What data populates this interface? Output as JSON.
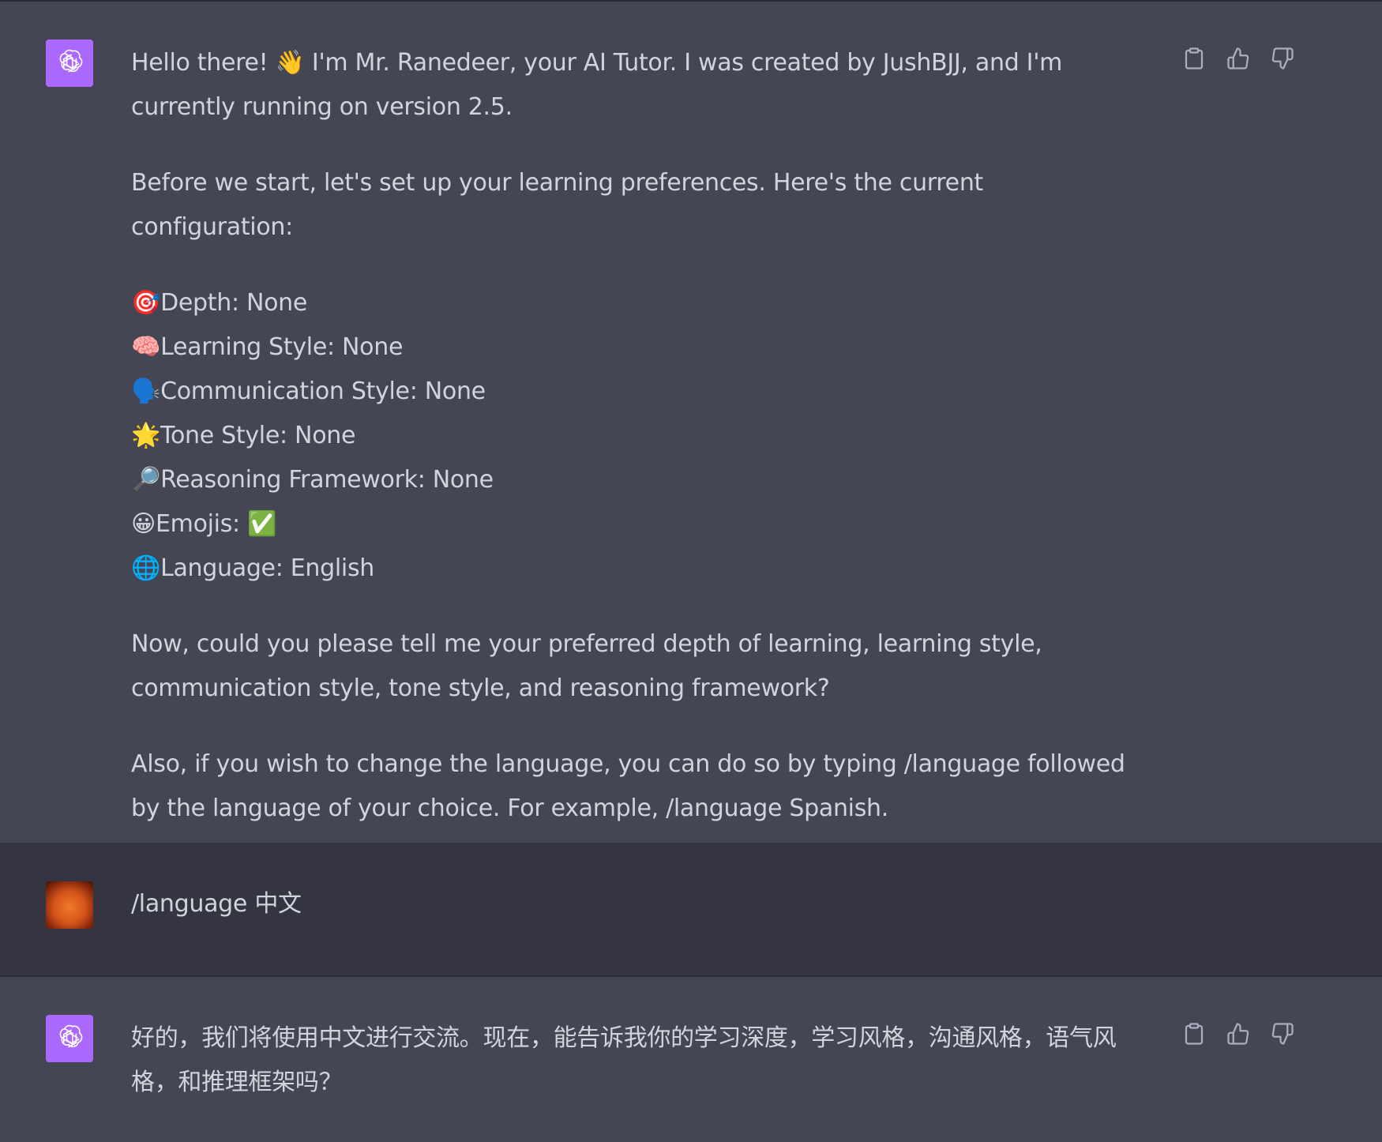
{
  "messages": {
    "assistant1": {
      "greeting": "Hello there! 👋 I'm Mr. Ranedeer, your AI Tutor. I was created by JushBJJ, and I'm currently running on version 2.5.",
      "setup": "Before we start, let's set up your learning preferences. Here's the current configuration:",
      "config": [
        {
          "icon": "🎯",
          "icon_name": "target-icon",
          "label": "Depth: None"
        },
        {
          "icon": "🧠",
          "icon_name": "brain-icon",
          "label": "Learning Style: None"
        },
        {
          "icon": "🗣️",
          "icon_name": "speaking-head-icon",
          "label": "Communication Style: None"
        },
        {
          "icon": "🌟",
          "icon_name": "star-icon",
          "label": "Tone Style: None"
        },
        {
          "icon": "🔎",
          "icon_name": "magnifier-icon",
          "label": "Reasoning Framework: None"
        },
        {
          "icon": "😀",
          "icon_name": "smile-icon",
          "label": "Emojis: ✅"
        },
        {
          "icon": "🌐",
          "icon_name": "globe-icon",
          "label": "Language: English"
        }
      ],
      "question": "Now, could you please tell me your preferred depth of learning, learning style, communication style, tone style, and reasoning framework?",
      "language_hint": "Also, if you wish to change the language, you can do so by typing /language followed by the language of your choice. For example, /language Spanish."
    },
    "user1": {
      "text": "/language 中文"
    },
    "assistant2": {
      "text": "好的，我们将使用中文进行交流。现在，能告诉我你的学习深度，学习风格，沟通风格，语气风格，和推理框架吗？"
    }
  },
  "icons": {
    "copy": "clipboard-icon",
    "like": "thumbs-up-icon",
    "dislike": "thumbs-down-icon",
    "assistant_avatar": "openai-logo-icon",
    "user_avatar": "user-avatar"
  },
  "colors": {
    "assistant_bg": "#444654",
    "user_bg": "#343541",
    "avatar_bg": "#ab68ff",
    "text": "#d1d5db",
    "icon": "#acacbe"
  }
}
